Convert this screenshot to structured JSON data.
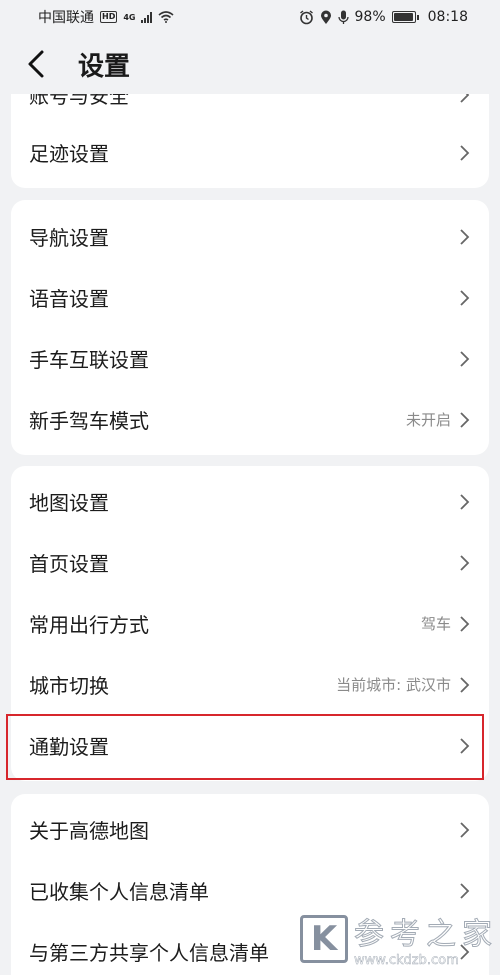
{
  "status_bar": {
    "carrier": "中国联通",
    "hd": "HD",
    "network": "4G",
    "battery_percent": "98%",
    "battery_level": 0.98,
    "time": "08:18"
  },
  "header": {
    "title": "设置"
  },
  "groups": [
    {
      "items": [
        {
          "label": "账号与安全",
          "value": ""
        },
        {
          "label": "足迹设置",
          "value": ""
        }
      ]
    },
    {
      "items": [
        {
          "label": "导航设置",
          "value": ""
        },
        {
          "label": "语音设置",
          "value": ""
        },
        {
          "label": "手车互联设置",
          "value": ""
        },
        {
          "label": "新手驾车模式",
          "value": "未开启"
        }
      ]
    },
    {
      "items": [
        {
          "label": "地图设置",
          "value": ""
        },
        {
          "label": "首页设置",
          "value": ""
        },
        {
          "label": "常用出行方式",
          "value": "驾车"
        },
        {
          "label": "城市切换",
          "value": "当前城市: 武汉市"
        },
        {
          "label": "通勤设置",
          "value": ""
        }
      ]
    },
    {
      "items": [
        {
          "label": "关于高德地图",
          "value": ""
        },
        {
          "label": "已收集个人信息清单",
          "value": ""
        },
        {
          "label": "与第三方共享个人信息清单",
          "value": ""
        }
      ]
    }
  ],
  "watermark": {
    "logo": "K",
    "text": "参考之家",
    "url": "www.ckdzb.com"
  },
  "colors": {
    "highlight": "#d7262c",
    "background": "#f1f2f4"
  }
}
